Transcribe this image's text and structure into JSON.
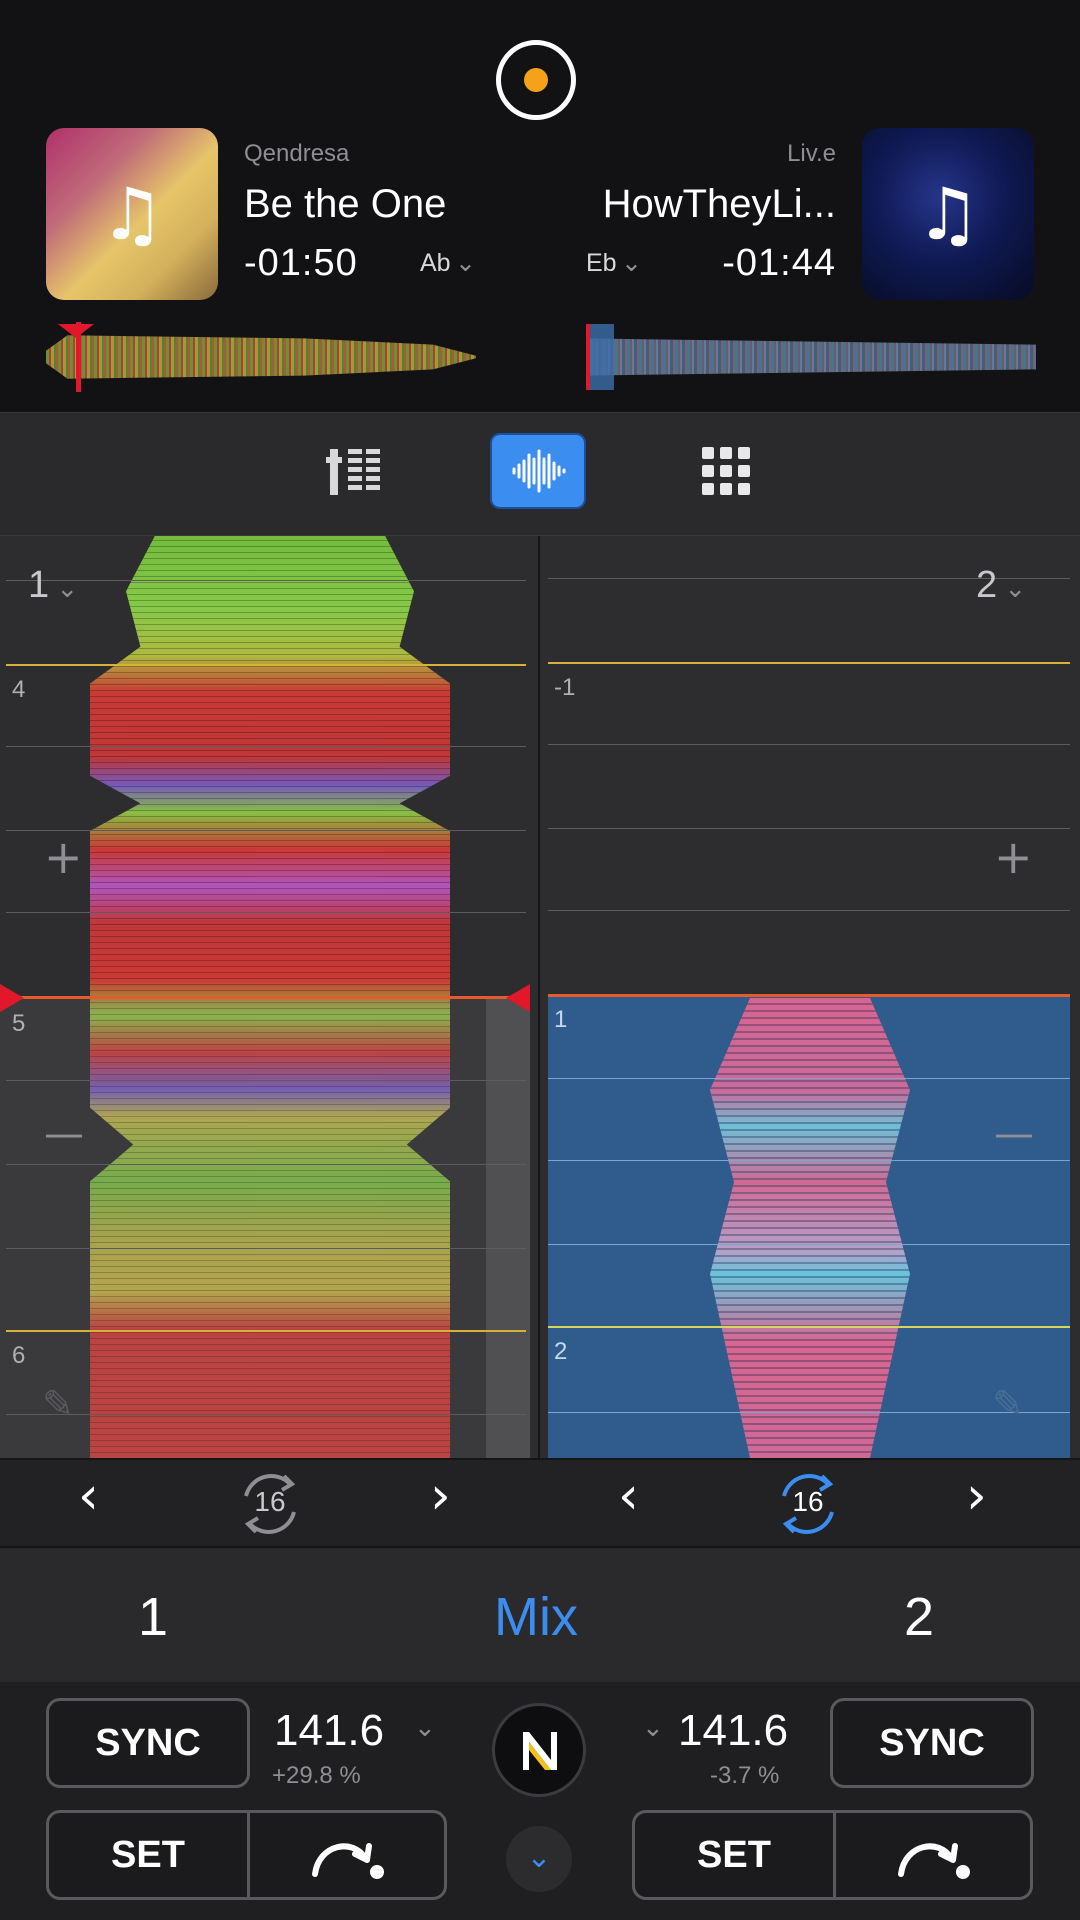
{
  "header": {
    "record_button": "record-button",
    "deck1": {
      "artist": "Qendresa",
      "title": "Be the One",
      "time": "-01:50",
      "key": "Ab"
    },
    "deck2": {
      "artist": "Liv.e",
      "title": "HowTheyLi...",
      "time": "-01:44",
      "key": "Eb"
    }
  },
  "toolbar": {
    "tabs": [
      "mixer-tab",
      "waveform-tab",
      "pads-tab"
    ],
    "active_tab": "waveform-tab"
  },
  "deck1_view": {
    "deck_label": "1",
    "beat_labels": [
      "4",
      "5",
      "6"
    ],
    "zoom_in": "+",
    "zoom_out": "—"
  },
  "deck2_view": {
    "deck_label": "2",
    "beat_labels": [
      "-1",
      "1",
      "2"
    ],
    "zoom_in": "+",
    "zoom_out": "—"
  },
  "loop": {
    "deck1_beats": "16",
    "deck2_beats": "16"
  },
  "mix_bar": {
    "left": "1",
    "center": "Mix",
    "right": "2"
  },
  "controls": {
    "deck1": {
      "sync": "SYNC",
      "bpm": "141.6",
      "pitch": "+29.8 %",
      "set": "SET"
    },
    "deck2": {
      "sync": "SYNC",
      "bpm": "141.6",
      "pitch": "-3.7 %",
      "set": "SET"
    }
  },
  "colors": {
    "accent": "#3b8df0",
    "playhead": "#e0182a",
    "record_dot": "#f3a21a"
  }
}
